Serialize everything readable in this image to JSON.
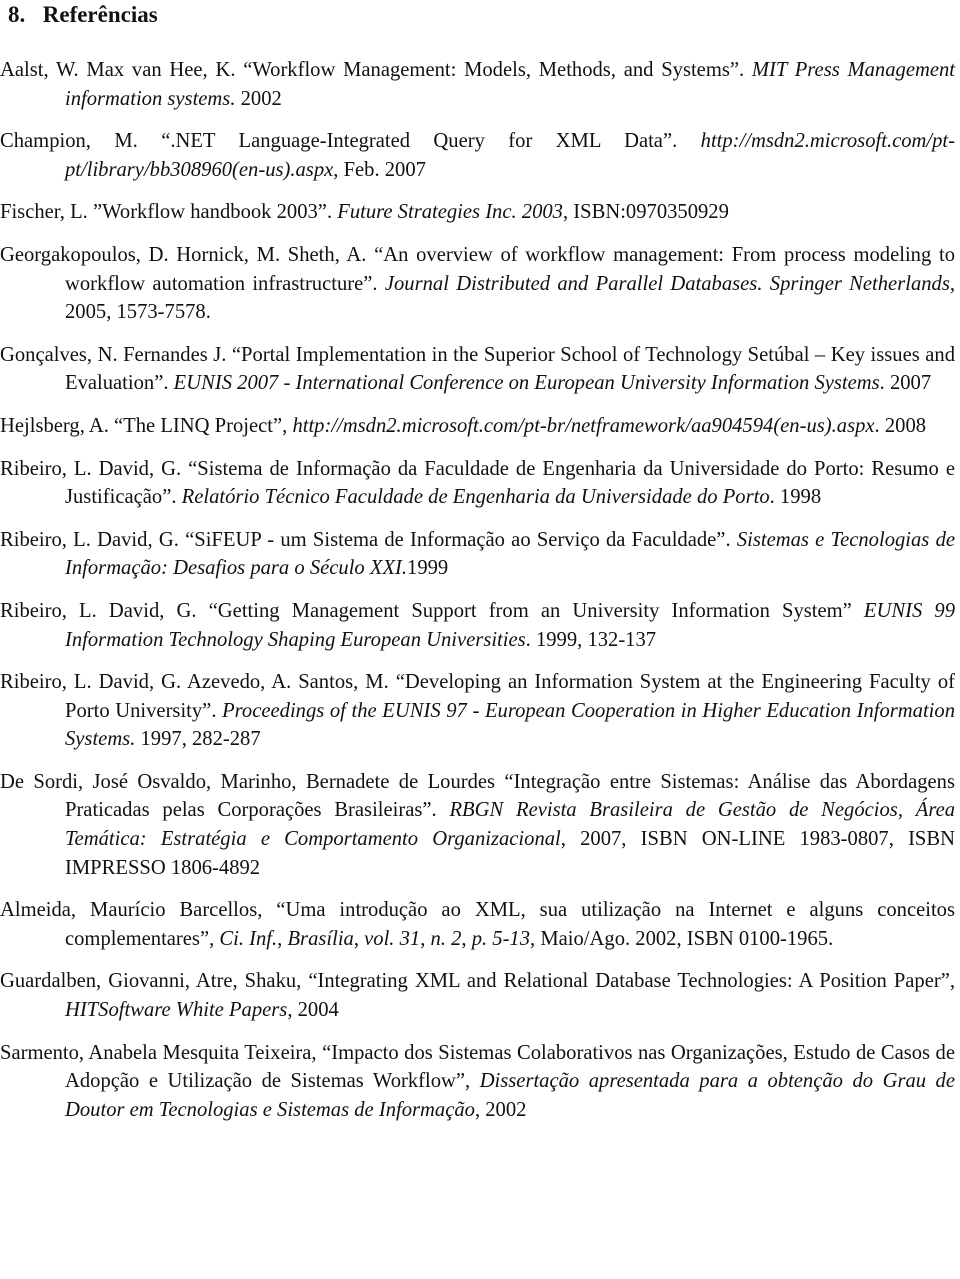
{
  "section": {
    "number": "8.",
    "title": "Referências"
  },
  "references": [
    {
      "segments": [
        {
          "text": "Aalst, W. Max van Hee, K. “Workflow Management: Models, Methods, and Systems”. ",
          "italic": false
        },
        {
          "text": "MIT Press Management information systems.",
          "italic": true
        },
        {
          "text": " 2002",
          "italic": false
        }
      ]
    },
    {
      "segments": [
        {
          "text": "Champion, M. “.NET Language-Integrated Query for XML Data”. ",
          "italic": false
        },
        {
          "text": "http://msdn2.microsoft.com/pt-pt/library/bb308960(en-us).aspx",
          "italic": true
        },
        {
          "text": ", Feb. 2007",
          "italic": false
        }
      ]
    },
    {
      "segments": [
        {
          "text": "Fischer, L. ”Workflow handbook 2003”. ",
          "italic": false
        },
        {
          "text": "Future Strategies Inc. 2003",
          "italic": true
        },
        {
          "text": ", ISBN:0970350929",
          "italic": false
        }
      ]
    },
    {
      "segments": [
        {
          "text": "Georgakopoulos, D. Hornick, M. Sheth, A. “An overview of workflow management: From process modeling to workflow automation infrastructure”. ",
          "italic": false
        },
        {
          "text": "Journal Distributed and Parallel Databases. Springer Netherlands",
          "italic": true
        },
        {
          "text": ", 2005, 1573-7578.",
          "italic": false
        }
      ]
    },
    {
      "segments": [
        {
          "text": "Gonçalves, N. Fernandes J. “Portal Implementation in the Superior School of Technology Setúbal – Key issues and Evaluation”. ",
          "italic": false
        },
        {
          "text": "EUNIS 2007 - International Conference on European University Information Systems",
          "italic": true
        },
        {
          "text": ". 2007",
          "italic": false
        }
      ]
    },
    {
      "segments": [
        {
          "text": "Hejlsberg, A. “The LINQ Project”, ",
          "italic": false
        },
        {
          "text": "http://msdn2.microsoft.com/pt-br/netframework/aa904594(en-us).aspx",
          "italic": true
        },
        {
          "text": ". 2008",
          "italic": false
        }
      ]
    },
    {
      "segments": [
        {
          "text": "Ribeiro, L. David, G. “Sistema de Informação da Faculdade de Engenharia da Universidade do Porto: Resumo e Justificação”. ",
          "italic": false
        },
        {
          "text": "Relatório Técnico Faculdade de Engenharia da Universidade do Porto",
          "italic": true
        },
        {
          "text": ". 1998",
          "italic": false
        }
      ]
    },
    {
      "segments": [
        {
          "text": "Ribeiro, L. David, G. “SiFEUP - um Sistema de Informação ao Serviço da Faculdade”. ",
          "italic": false
        },
        {
          "text": "Sistemas e Tecnologias de Informação: Desafios para o Século XXI.",
          "italic": true
        },
        {
          "text": "1999",
          "italic": false
        }
      ]
    },
    {
      "segments": [
        {
          "text": "Ribeiro, L. David, G. “Getting Management Support from an University Information System” ",
          "italic": false
        },
        {
          "text": "EUNIS 99 Information Technology Shaping European Universities",
          "italic": true
        },
        {
          "text": ". 1999, 132-137",
          "italic": false
        }
      ]
    },
    {
      "segments": [
        {
          "text": "Ribeiro, L. David, G. Azevedo, A. Santos, M. “Developing an Information System at the Engineering Faculty of Porto University”. ",
          "italic": false
        },
        {
          "text": "Proceedings of the EUNIS 97 - European Cooperation in Higher Education Information Systems.",
          "italic": true
        },
        {
          "text": " 1997, 282-287",
          "italic": false
        }
      ]
    },
    {
      "segments": [
        {
          "text": "De Sordi, José Osvaldo, Marinho, Bernadete de Lourdes “Integração entre Sistemas: Análise das Abordagens Praticadas pelas Corporações Brasileiras”. ",
          "italic": false
        },
        {
          "text": "RBGN Revista Brasileira de Gestão de Negócios, Área Temática: Estratégia e Comportamento Organizacional",
          "italic": true
        },
        {
          "text": ", 2007, ISBN ON-LINE 1983-0807, ISBN IMPRESSO 1806-4892",
          "italic": false
        }
      ]
    },
    {
      "segments": [
        {
          "text": "Almeida, Maurício Barcellos, “Uma introdução ao XML, sua utilização na Internet e alguns conceitos complementares”, ",
          "italic": false
        },
        {
          "text": "Ci. Inf.",
          "italic": true
        },
        {
          "text": ", ",
          "italic": false
        },
        {
          "text": "Brasília",
          "italic": true
        },
        {
          "text": ", ",
          "italic": false
        },
        {
          "text": "vol. 31",
          "italic": true
        },
        {
          "text": ", ",
          "italic": false
        },
        {
          "text": "n. 2",
          "italic": true
        },
        {
          "text": ", ",
          "italic": false
        },
        {
          "text": "p. 5-13",
          "italic": true
        },
        {
          "text": ", Maio/Ago. 2002, ISBN 0100-1965.",
          "italic": false
        }
      ]
    },
    {
      "segments": [
        {
          "text": "Guardalben, Giovanni, Atre, Shaku, “Integrating XML and Relational Database Technologies: A Position Paper”, ",
          "italic": false
        },
        {
          "text": "HITSoftware White Papers",
          "italic": true
        },
        {
          "text": ", 2004",
          "italic": false
        }
      ]
    },
    {
      "segments": [
        {
          "text": "Sarmento, Anabela Mesquita Teixeira, “Impacto dos Sistemas Colaborativos nas Organizações, Estudo de Casos de Adopção e Utilização de Sistemas Workflow”, ",
          "italic": false
        },
        {
          "text": "Dissertação apresentada para a obtenção do Grau de Doutor em Tecnologias e Sistemas de Informação",
          "italic": true
        },
        {
          "text": ", 2002",
          "italic": false
        }
      ]
    }
  ]
}
